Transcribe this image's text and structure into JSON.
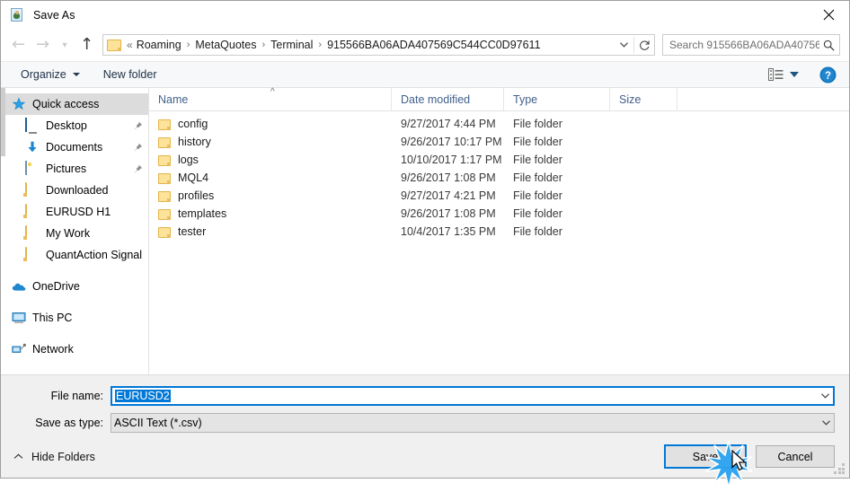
{
  "window": {
    "title": "Save As",
    "title_icon": "save-as-icon",
    "close_icon": "close-icon"
  },
  "nav": {
    "back_icon": "back-arrow-icon",
    "forward_icon": "forward-arrow-icon",
    "recent_icon": "chevron-down-icon",
    "up_icon": "up-arrow-icon",
    "folder_icon": "folder-icon",
    "breadcrumb_prefix": "«",
    "breadcrumbs": [
      "Roaming",
      "MetaQuotes",
      "Terminal",
      "915566BA06ADA407569C544CC0D97611"
    ],
    "separator": "›",
    "dropdown_icon": "chevron-down-icon",
    "refresh_icon": "refresh-icon"
  },
  "search": {
    "placeholder": "Search 915566BA06ADA40756...",
    "icon": "search-icon"
  },
  "toolbar": {
    "organize_label": "Organize",
    "new_folder_label": "New folder",
    "view_icon": "list-view-icon",
    "view_caret_icon": "chevron-down-icon",
    "help_icon": "help-icon"
  },
  "sidebar": {
    "items": [
      {
        "label": "Quick access",
        "icon": "star-icon",
        "selected": true,
        "pinned": false,
        "indent": 0
      },
      {
        "label": "Desktop",
        "icon": "monitor-icon",
        "selected": false,
        "pinned": true,
        "indent": 1
      },
      {
        "label": "Documents",
        "icon": "download-arrow-icon",
        "selected": false,
        "pinned": true,
        "indent": 1
      },
      {
        "label": "Pictures",
        "icon": "pictures-icon",
        "selected": false,
        "pinned": true,
        "indent": 1
      },
      {
        "label": "Downloaded",
        "icon": "folder-icon",
        "selected": false,
        "pinned": false,
        "indent": 1
      },
      {
        "label": "EURUSD H1",
        "icon": "folder-icon",
        "selected": false,
        "pinned": false,
        "indent": 1
      },
      {
        "label": "My Work",
        "icon": "folder-icon",
        "selected": false,
        "pinned": false,
        "indent": 1
      },
      {
        "label": "QuantAction Signal",
        "icon": "folder-icon",
        "selected": false,
        "pinned": false,
        "indent": 1
      },
      {
        "label": "OneDrive",
        "icon": "onedrive-cloud-icon",
        "selected": false,
        "pinned": false,
        "indent": 0,
        "gap": true
      },
      {
        "label": "This PC",
        "icon": "this-pc-icon",
        "selected": false,
        "pinned": false,
        "indent": 0,
        "gap": true
      },
      {
        "label": "Network",
        "icon": "network-icon",
        "selected": false,
        "pinned": false,
        "indent": 0,
        "gap": true
      }
    ]
  },
  "file_list": {
    "columns": [
      "Name",
      "Date modified",
      "Type",
      "Size"
    ],
    "sort_column": "Name",
    "sort_direction": "ascending",
    "rows": [
      {
        "name": "config",
        "date": "9/27/2017 4:44 PM",
        "type": "File folder",
        "size": ""
      },
      {
        "name": "history",
        "date": "9/26/2017 10:17 PM",
        "type": "File folder",
        "size": ""
      },
      {
        "name": "logs",
        "date": "10/10/2017 1:17 PM",
        "type": "File folder",
        "size": ""
      },
      {
        "name": "MQL4",
        "date": "9/26/2017 1:08 PM",
        "type": "File folder",
        "size": ""
      },
      {
        "name": "profiles",
        "date": "9/27/2017 4:21 PM",
        "type": "File folder",
        "size": ""
      },
      {
        "name": "templates",
        "date": "9/26/2017 1:08 PM",
        "type": "File folder",
        "size": ""
      },
      {
        "name": "tester",
        "date": "10/4/2017 1:35 PM",
        "type": "File folder",
        "size": ""
      }
    ]
  },
  "form": {
    "file_name_label": "File name:",
    "file_name_value": "EURUSD2",
    "save_as_type_label": "Save as type:",
    "save_as_type_value": "ASCII Text (*.csv)"
  },
  "footer": {
    "hide_folders_label": "Hide Folders",
    "hide_folders_caret": "⌃",
    "save_label": "Save",
    "cancel_label": "Cancel"
  },
  "colors": {
    "accent": "#0078d7",
    "selection": "#0078d7",
    "folder": "#fde29a",
    "header_text": "#41618c"
  }
}
